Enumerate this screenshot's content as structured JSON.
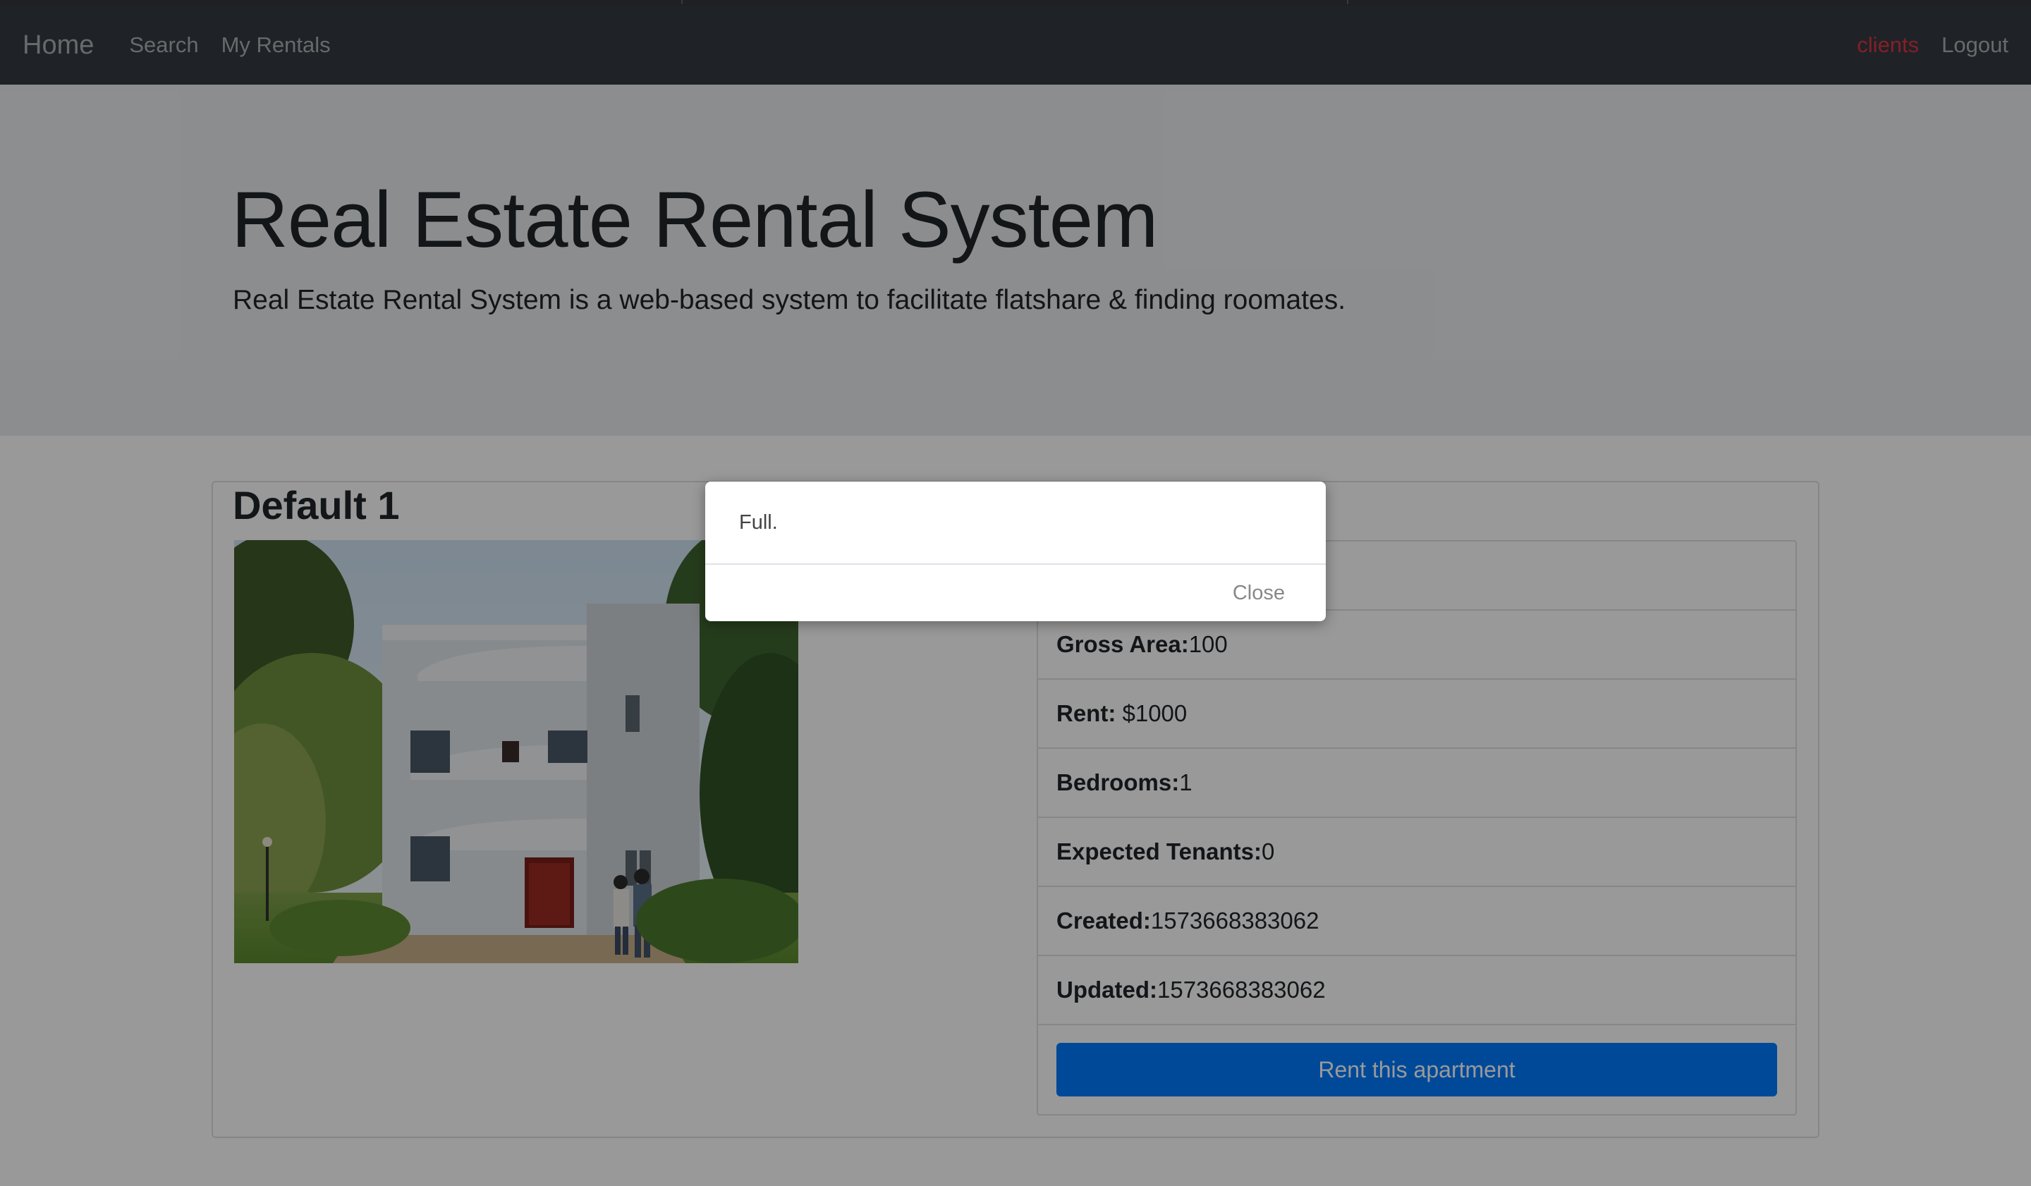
{
  "navbar": {
    "brand": "Home",
    "links": [
      "Search",
      "My Rentals"
    ],
    "user": "clients",
    "logout": "Logout"
  },
  "jumbotron": {
    "title": "Real Estate Rental System",
    "lead": "Real Estate Rental System is a web-based system to facilitate flatshare & finding roomates."
  },
  "listing": {
    "title": "Default 1",
    "details": [
      {
        "label": "",
        "value": ""
      },
      {
        "label": "Gross Area:",
        "value": "100"
      },
      {
        "label": "Rent:",
        "value": " $1000"
      },
      {
        "label": "Bedrooms:",
        "value": "1"
      },
      {
        "label": "Expected Tenants:",
        "value": "0"
      },
      {
        "label": "Created:",
        "value": "1573668383062"
      },
      {
        "label": "Updated:",
        "value": "1573668383062"
      }
    ],
    "rent_button": "Rent this apartment"
  },
  "modal": {
    "message": "Full.",
    "close_label": "Close"
  },
  "colors": {
    "navbar_bg": "#343a40",
    "user_link": "#dc3545",
    "primary": "#007bff"
  }
}
